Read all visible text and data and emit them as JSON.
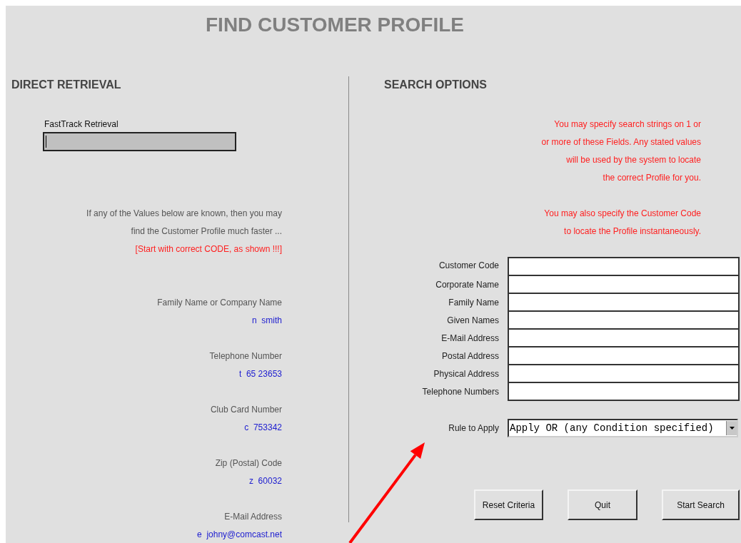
{
  "title": "FIND CUSTOMER PROFILE",
  "direct_retrieval": {
    "heading": "DIRECT RETRIEVAL",
    "fasttrack": {
      "label": "FastTrack Retrieval",
      "focused": true
    },
    "intro": [
      {
        "text": "If any of the Values below are known, then you may",
        "kind": "note"
      },
      {
        "text": "find the Customer Profile much faster ...",
        "kind": "note"
      },
      {
        "text": "[Start with correct CODE, as shown !!!]",
        "kind": "warning"
      }
    ],
    "hints": [
      {
        "label": "Family Name or Company Name",
        "example": "n  smith"
      },
      {
        "label": "Telephone Number",
        "example": "t  65 23653"
      },
      {
        "label": "Club Card Number",
        "example": "c  753342"
      },
      {
        "label": "Zip (Postal) Code",
        "example": "z  60032"
      },
      {
        "label": "E-Mail Address",
        "example": "e  johny@comcast.net"
      }
    ]
  },
  "search_options": {
    "heading": "SEARCH OPTIONS",
    "notes": [
      {
        "lines": [
          "You may specify search strings on 1 or",
          "or more of these Fields. Any stated values",
          "will be used by the system to locate",
          "the correct Profile for you."
        ]
      },
      {
        "lines": [
          "You may also specify the Customer Code",
          "to locate the Profile instantaneously."
        ]
      }
    ],
    "fields": [
      {
        "label": "Customer Code"
      },
      {
        "label": "Corporate Name"
      },
      {
        "label": "Family Name"
      },
      {
        "label": "Given Names"
      },
      {
        "label": "E-Mail Address"
      },
      {
        "label": "Postal Address"
      },
      {
        "label": "Physical Address"
      },
      {
        "label": "Telephone Numbers"
      }
    ],
    "rule": {
      "label": "Rule to Apply",
      "value": "Apply OR (any Condition specified)"
    },
    "buttons": [
      "Reset Criteria",
      "Quit",
      "Start Search"
    ]
  }
}
